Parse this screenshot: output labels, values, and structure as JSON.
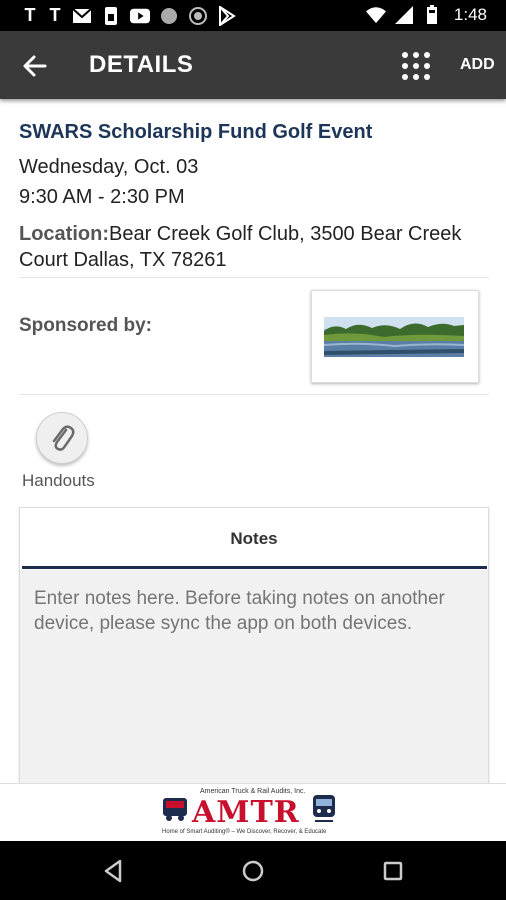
{
  "status_bar": {
    "left_letters": [
      "T",
      "T"
    ],
    "icons": [
      "gmail-icon",
      "sim-icon",
      "youtube-icon",
      "circle-icon",
      "shield-icon",
      "play-store-icon"
    ],
    "right_icons": [
      "wifi-icon",
      "signal-icon",
      "battery-icon"
    ],
    "time": "1:48"
  },
  "app_bar": {
    "title": "DETAILS",
    "add_label": "ADD"
  },
  "event": {
    "title": "SWARS Scholarship Fund Golf Event",
    "date": "Wednesday, Oct. 03",
    "time": "9:30 AM - 2:30 PM",
    "location_label": "Location:",
    "location": "Bear Creek Golf Club, 3500 Bear Creek Court Dallas, TX 78261"
  },
  "sponsor": {
    "label": "Sponsored by:"
  },
  "handouts": {
    "label": "Handouts"
  },
  "notes": {
    "header": "Notes",
    "placeholder": "Enter notes here. Before taking notes on another device, please sync the app on both devices."
  },
  "banner": {
    "top_text": "American Truck & Rail Audits, Inc.",
    "logo_text": "AMTR",
    "tagline": "Home of Smart Auditing® – We Discover, Recover, & Educate"
  },
  "colors": {
    "app_bar": "#3a3a3a",
    "title_blue": "#1d3557",
    "notes_accent": "#1d2b4c",
    "logo_red": "#c8102e"
  }
}
